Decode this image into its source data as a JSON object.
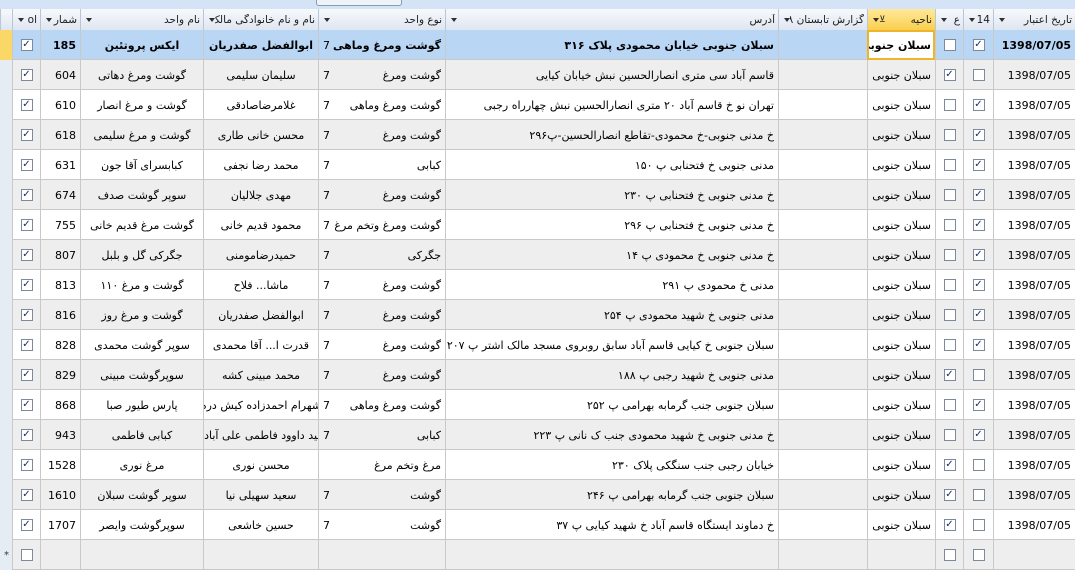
{
  "columns": {
    "c0": "تاریخ اعتبار",
    "c1": "14",
    "c2": "ع",
    "c3": "ناحیه",
    "c4": "گزارش تابستان ۹۸",
    "c5": "آدرس",
    "c6": "نوع واحد",
    "c7": "نام و نام خانوادگی مالک",
    "c8": "نام واحد",
    "c9": "شمار",
    "c10": "ol"
  },
  "rows": [
    {
      "date": "1398/07/05",
      "cb14": true,
      "cbE": false,
      "region": "سبلان جنوبی",
      "report": "",
      "address": "سبلان جنوبی خیابان محمودی پلاک ۳۱۶",
      "typeCode": "7",
      "type": "گوشت ومرغ وماهی",
      "owner": "ابوالفضل صفدریان",
      "unit": "ایکس پروتئین",
      "num": "185",
      "cbL": true
    },
    {
      "date": "1398/07/05",
      "cb14": false,
      "cbE": true,
      "region": "سبلان جنوبی",
      "report": "",
      "address": "قاسم آباد سی متری انصارالحسین نبش خیابان کیایی",
      "typeCode": "7",
      "type": "گوشت ومرغ",
      "owner": "سلیمان سلیمی",
      "unit": "گوشت ومرغ دهاتی",
      "num": "604",
      "cbL": true
    },
    {
      "date": "1398/07/05",
      "cb14": true,
      "cbE": false,
      "region": "سبلان جنوبی",
      "report": "",
      "address": "تهران نو خ قاسم آباد ۲۰ متری انصارالحسین نبش چهارراه رجبی",
      "typeCode": "7",
      "type": "گوشت ومرغ وماهی",
      "owner": "غلامرضاصادقی",
      "unit": "گوشت و مرغ انصار",
      "num": "610",
      "cbL": true
    },
    {
      "date": "1398/07/05",
      "cb14": true,
      "cbE": false,
      "region": "سبلان جنوبی",
      "report": "",
      "address": "خ مدنی جنوبی-خ محمودی-تقاطع انصارالحسین-پ۲۹۶",
      "typeCode": "7",
      "type": "گوشت ومرغ",
      "owner": "محسن خانی طاری",
      "unit": "گوشت و مرغ سلیمی",
      "num": "618",
      "cbL": true
    },
    {
      "date": "1398/07/05",
      "cb14": true,
      "cbE": false,
      "region": "سبلان جنوبی",
      "report": "",
      "address": "مدنی جنوبی خ فتحنابی پ ۱۵۰",
      "typeCode": "7",
      "type": "کبابی",
      "owner": "محمد رضا نجفی",
      "unit": "کبابسرای آقا جون",
      "num": "631",
      "cbL": true
    },
    {
      "date": "1398/07/05",
      "cb14": true,
      "cbE": false,
      "region": "سبلان جنوبی",
      "report": "",
      "address": "خ مدنی جنوبی خ فتحنابی پ ۲۳۰",
      "typeCode": "7",
      "type": "گوشت ومرغ",
      "owner": "مهدی جلالیان",
      "unit": "سوپر گوشت صدف",
      "num": "674",
      "cbL": true
    },
    {
      "date": "1398/07/05",
      "cb14": true,
      "cbE": false,
      "region": "سبلان جنوبی",
      "report": "",
      "address": "خ مدنی جنوبی خ فتحنابی پ ۲۹۶",
      "typeCode": "7",
      "type": "گوشت ومرغ وتخم مرغ",
      "owner": "محمود قدیم خانی",
      "unit": "گوشت مرغ قدیم خانی",
      "num": "755",
      "cbL": true
    },
    {
      "date": "1398/07/05",
      "cb14": true,
      "cbE": false,
      "region": "سبلان جنوبی",
      "report": "",
      "address": "خ مدنی جنوبی خ محمودی پ ۱۴",
      "typeCode": "7",
      "type": "جگرکی",
      "owner": "حمیدرضامومنی",
      "unit": "جگرکی گل و بلبل",
      "num": "807",
      "cbL": true
    },
    {
      "date": "1398/07/05",
      "cb14": true,
      "cbE": false,
      "region": "سبلان جنوبی",
      "report": "",
      "address": "مدنی خ محمودی پ ۲۹۱",
      "typeCode": "7",
      "type": "گوشت ومرغ",
      "owner": "ماشا... فلاح",
      "unit": "گوشت و مرغ ۱۱۰",
      "num": "813",
      "cbL": true
    },
    {
      "date": "1398/07/05",
      "cb14": true,
      "cbE": false,
      "region": "سبلان جنوبی",
      "report": "",
      "address": "مدنی جنوبی خ شهید محمودی پ ۲۵۴",
      "typeCode": "7",
      "type": "گوشت ومرغ",
      "owner": "ابوالفضل صفدریان",
      "unit": "گوشت و مرغ روز",
      "num": "816",
      "cbL": true
    },
    {
      "date": "1398/07/05",
      "cb14": true,
      "cbE": false,
      "region": "سبلان جنوبی",
      "report": "",
      "address": "سبلان جنوبی خ کیایی قاسم آباد سابق روبروی مسجد مالک اشتر پ ۲۰۷",
      "typeCode": "7",
      "type": "گوشت ومرغ",
      "owner": "قدرت ا... آقا محمدی",
      "unit": "سوپر گوشت محمدی",
      "num": "828",
      "cbL": true
    },
    {
      "date": "1398/07/05",
      "cb14": false,
      "cbE": true,
      "region": "سبلان جنوبی",
      "report": "",
      "address": "مدنی جنوبی خ شهید رجبی پ ۱۸۸",
      "typeCode": "7",
      "type": "گوشت ومرغ",
      "owner": "محمد مبینی کشه",
      "unit": "سوپرگوشت مبینی",
      "num": "829",
      "cbL": true
    },
    {
      "date": "1398/07/05",
      "cb14": true,
      "cbE": false,
      "region": "سبلان جنوبی",
      "report": "",
      "address": "سبلان جنوبی جنب گرمابه بهرامی پ ۲۵۲",
      "typeCode": "7",
      "type": "گوشت ومرغ وماهی",
      "owner": "شهرام احمدزاده کیش دره",
      "unit": "پارس طیور صبا",
      "num": "868",
      "cbL": true
    },
    {
      "date": "1398/07/05",
      "cb14": true,
      "cbE": false,
      "region": "سبلان جنوبی",
      "report": "",
      "address": "خ مدنی جنوبی خ شهید محمودی جنب ک نانی پ ۲۲۳",
      "typeCode": "7",
      "type": "کبابی",
      "owner": "سید داوود فاطمی علی آبادی",
      "unit": "کبابی فاطمی",
      "num": "943",
      "cbL": true
    },
    {
      "date": "1398/07/05",
      "cb14": false,
      "cbE": true,
      "region": "سبلان جنوبی",
      "report": "",
      "address": "خیابان رجبی جنب سنگکی پلاک ۲۳۰",
      "typeCode": "",
      "type": "مرغ وتخم مرغ",
      "owner": "محسن نوری",
      "unit": "مرغ نوری",
      "num": "1528",
      "cbL": true
    },
    {
      "date": "1398/07/05",
      "cb14": false,
      "cbE": true,
      "region": "سبلان جنوبی",
      "report": "",
      "address": "سبلان جنوبی جنب گرمابه بهرامی پ ۲۴۶",
      "typeCode": "7",
      "type": "گوشت",
      "owner": "سعید سهیلی نیا",
      "unit": "سوپر گوشت سبلان",
      "num": "1610",
      "cbL": true
    },
    {
      "date": "1398/07/05",
      "cb14": false,
      "cbE": true,
      "region": "سبلان جنوبی",
      "report": "",
      "address": "خ دماوند ایستگاه قاسم آباد خ شهید کیایی پ ۳۷",
      "typeCode": "7",
      "type": "گوشت",
      "owner": "حسین خاشعی",
      "unit": "سوپرگوشت وایصر",
      "num": "1707",
      "cbL": true
    }
  ],
  "newRow": {
    "marker": "*"
  },
  "icons": {
    "checkmark": "check-icon",
    "dropdown": "chevron-down-icon",
    "filter": "filter-icon",
    "sort": "sort-icon"
  }
}
